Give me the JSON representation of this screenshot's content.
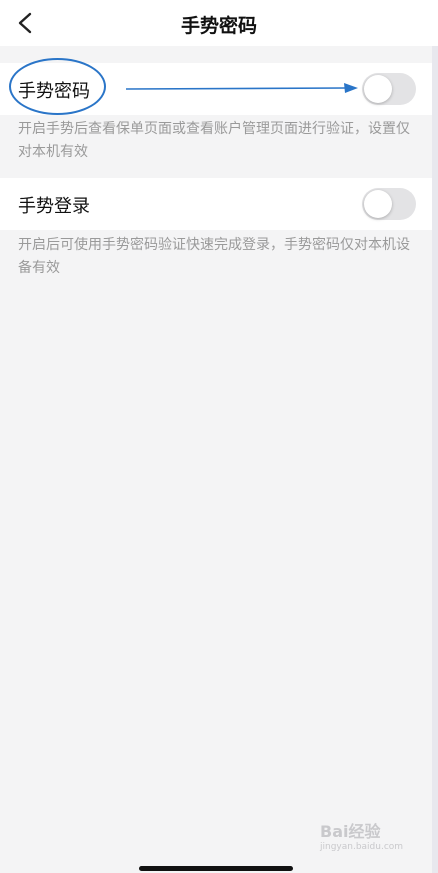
{
  "header": {
    "title": "手势密码"
  },
  "settings": [
    {
      "label": "手势密码",
      "enabled": false,
      "description": "开启手势后查看保单页面或查看账户管理页面进行验证，设置仅对本机有效"
    },
    {
      "label": "手势登录",
      "enabled": false,
      "description": "开启后可使用手势密码验证快速完成登录，手势密码仅对本机设备有效"
    }
  ],
  "watermark": {
    "main": "Bai经验",
    "sub": "jingyan.baidu.com"
  },
  "colors": {
    "annotation": "#2a75c8",
    "toggle_off": "#e3e3e5",
    "background": "#f4f4f5"
  }
}
